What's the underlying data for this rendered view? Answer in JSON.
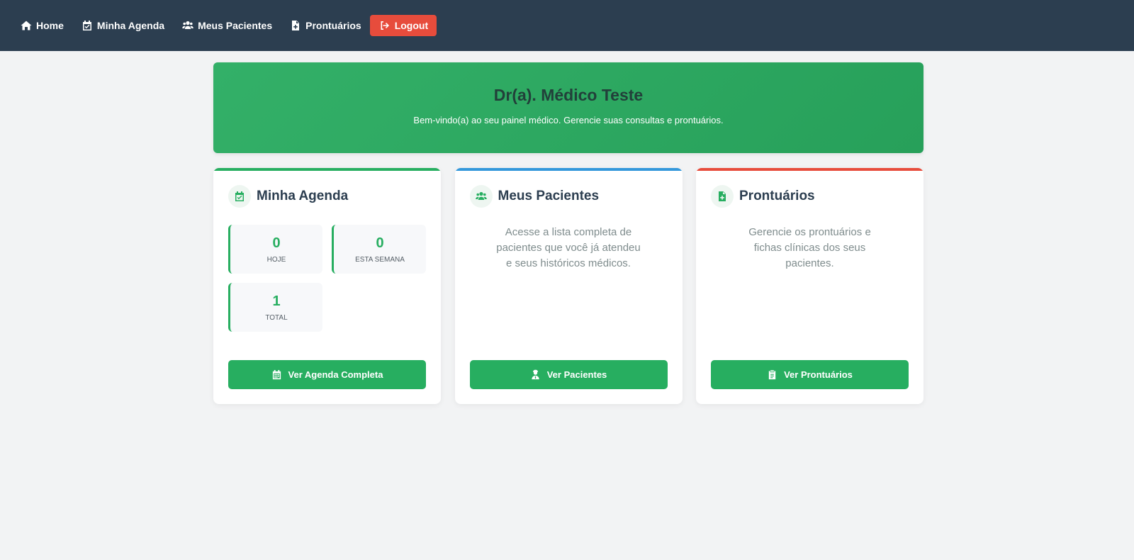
{
  "nav": {
    "items": [
      {
        "label": "Home",
        "icon": "home-icon"
      },
      {
        "label": "Minha Agenda",
        "icon": "calendar-check-icon"
      },
      {
        "label": "Meus Pacientes",
        "icon": "users-icon"
      },
      {
        "label": "Prontuários",
        "icon": "file-medical-icon"
      }
    ],
    "logout": {
      "label": "Logout",
      "icon": "sign-out-icon"
    }
  },
  "hero": {
    "title": "Dr(a). Médico Teste",
    "subtitle": "Bem-vindo(a) ao seu painel médico. Gerencie suas consultas e prontuários."
  },
  "cards": {
    "agenda": {
      "title": "Minha Agenda",
      "icon": "calendar-check-icon",
      "accent": "#27ae60",
      "stats": [
        {
          "value": "0",
          "label": "HOJE"
        },
        {
          "value": "0",
          "label": "ESTA SEMANA"
        },
        {
          "value": "1",
          "label": "TOTAL"
        }
      ],
      "button": {
        "label": "Ver Agenda Completa",
        "icon": "calendar-icon"
      }
    },
    "pacientes": {
      "title": "Meus Pacientes",
      "icon": "users-icon",
      "accent": "#3498db",
      "description": "Acesse a lista completa de pacientes que você já atendeu e seus históricos médicos.",
      "button": {
        "label": "Ver Pacientes",
        "icon": "user-doctor-icon"
      }
    },
    "prontuarios": {
      "title": "Prontuários",
      "icon": "file-medical-icon",
      "accent": "#e74c3c",
      "description": "Gerencie os prontuários e fichas clínicas dos seus pacientes.",
      "button": {
        "label": "Ver Prontuários",
        "icon": "clipboard-icon"
      }
    }
  },
  "colors": {
    "navbar": "#2c3e50",
    "background": "#f2f3f4",
    "primary": "#27ae60",
    "logout": "#e74c3c"
  }
}
